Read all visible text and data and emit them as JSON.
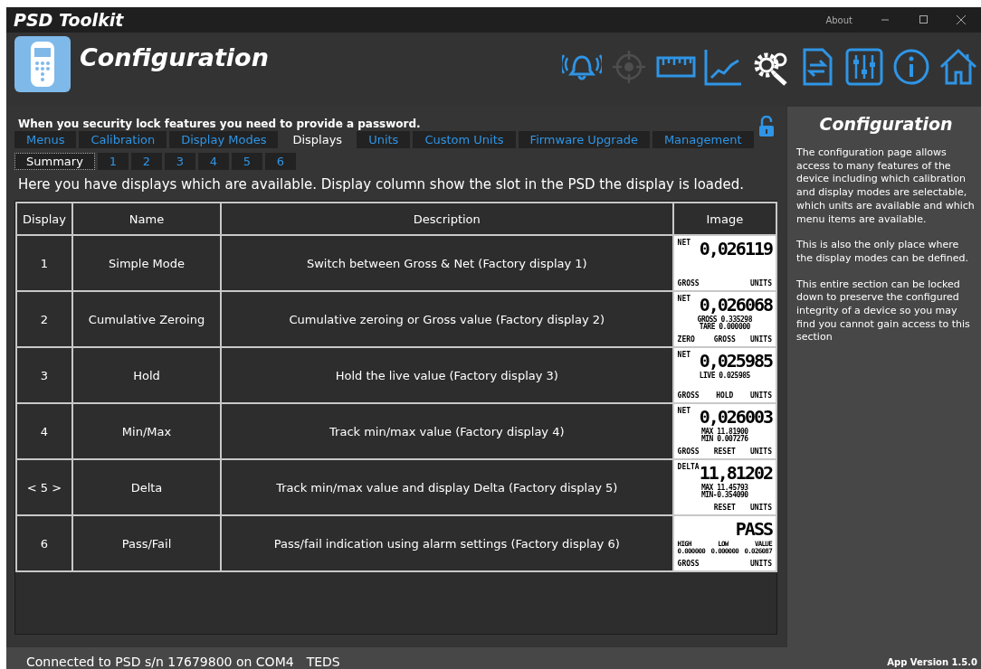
{
  "window": {
    "title": "PSD Toolkit",
    "about": "About"
  },
  "header": {
    "title": "Configuration"
  },
  "toolbar": [
    {
      "kind": "bell",
      "selected": false,
      "disabled": false
    },
    {
      "kind": "crosshair",
      "selected": false,
      "disabled": true
    },
    {
      "kind": "ruler",
      "selected": false,
      "disabled": false
    },
    {
      "kind": "chart",
      "selected": false,
      "disabled": false
    },
    {
      "kind": "gears",
      "selected": true,
      "disabled": false
    },
    {
      "kind": "transfer",
      "selected": false,
      "disabled": false
    },
    {
      "kind": "sliders",
      "selected": false,
      "disabled": false
    },
    {
      "kind": "info",
      "selected": false,
      "disabled": false
    },
    {
      "kind": "home",
      "selected": false,
      "disabled": false
    }
  ],
  "notice": "When you security lock features you need to provide a password.",
  "lock": {
    "locked": false
  },
  "tabs": [
    {
      "label": "Menus",
      "selected": false
    },
    {
      "label": "Calibration",
      "selected": false
    },
    {
      "label": "Display Modes",
      "selected": false
    },
    {
      "label": "Displays",
      "selected": true
    },
    {
      "label": "Units",
      "selected": false
    },
    {
      "label": "Custom Units",
      "selected": false
    },
    {
      "label": "Firmware Upgrade",
      "selected": false
    },
    {
      "label": "Management",
      "selected": false
    }
  ],
  "subtabs": [
    {
      "label": "Summary",
      "selected": true
    },
    {
      "label": "1",
      "selected": false
    },
    {
      "label": "2",
      "selected": false
    },
    {
      "label": "3",
      "selected": false
    },
    {
      "label": "4",
      "selected": false
    },
    {
      "label": "5",
      "selected": false
    },
    {
      "label": "6",
      "selected": false
    }
  ],
  "intro": "Here you have displays which are available. Display column show the slot in the PSD the display is loaded.",
  "table": {
    "columns": [
      "Display",
      "Name",
      "Description",
      "Image"
    ],
    "rows": [
      {
        "display": "1",
        "name": "Simple Mode",
        "description": "Switch between Gross & Net (Factory display 1)",
        "image": {
          "label": "NET",
          "value": "0,026119",
          "footer": {
            "left": "GROSS",
            "right": "UNITS"
          }
        }
      },
      {
        "display": "2",
        "name": "Cumulative Zeroing",
        "description": "Cumulative zeroing or Gross value (Factory display 2)",
        "image": {
          "label": "NET",
          "value": "0,026068",
          "lines": [
            [
              "GROSS 0.335298"
            ],
            [
              "TARE 0.000000"
            ]
          ],
          "footer": {
            "left": "ZERO",
            "center": "GROSS",
            "right": "UNITS"
          }
        }
      },
      {
        "display": "3",
        "name": "Hold",
        "description": "Hold the live value (Factory display 3)",
        "image": {
          "label": "NET",
          "value": "0,025985",
          "lines": [
            [
              "LIVE 0.025985"
            ]
          ],
          "footer": {
            "left": "GROSS",
            "center": "HOLD",
            "right": "UNITS"
          }
        }
      },
      {
        "display": "4",
        "name": "Min/Max",
        "description": "Track min/max value (Factory display 4)",
        "image": {
          "label": "NET",
          "value": "0,026003",
          "lines": [
            [
              "MAX 11.81900"
            ],
            [
              "MIN 0.007276"
            ]
          ],
          "footer": {
            "left": "GROSS",
            "center": "RESET",
            "right": "UNITS"
          }
        }
      },
      {
        "display": "< 5 >",
        "name": "Delta",
        "description": "Track min/max value and display Delta (Factory display 5)",
        "image": {
          "label": "DELTA",
          "value": "11,81202",
          "lines": [
            [
              "MAX 11.45793"
            ],
            [
              "MIN-0.354090"
            ]
          ],
          "footer": {
            "center": "RESET",
            "right": "UNITS"
          }
        }
      },
      {
        "display": "6",
        "name": "Pass/Fail",
        "description": "Pass/fail indication using alarm settings (Factory display 6)",
        "image": {
          "value": "PASS",
          "lines": [
            [
              "HIGH",
              "LOW",
              "VALUE"
            ],
            [
              "0.000000",
              "0.000000",
              "0.026087"
            ]
          ],
          "footer": {
            "left": "GROSS",
            "right": "UNITS"
          }
        }
      }
    ]
  },
  "side_panel": {
    "title": "Configuration",
    "paragraphs": [
      "The configuration page allows access to many features of the device including which calibration and display modes are selectable, which units are available and which menu items are available.",
      "This is also the only place where the display modes can be defined.",
      "This entire section can be locked down to preserve the configured integrity of a device so you may find you cannot gain access to this section"
    ]
  },
  "status_bar": {
    "connection": "Connected to PSD s/n 17679800 on COM4",
    "mode": "TEDS",
    "version": "App Version 1.5.0"
  }
}
